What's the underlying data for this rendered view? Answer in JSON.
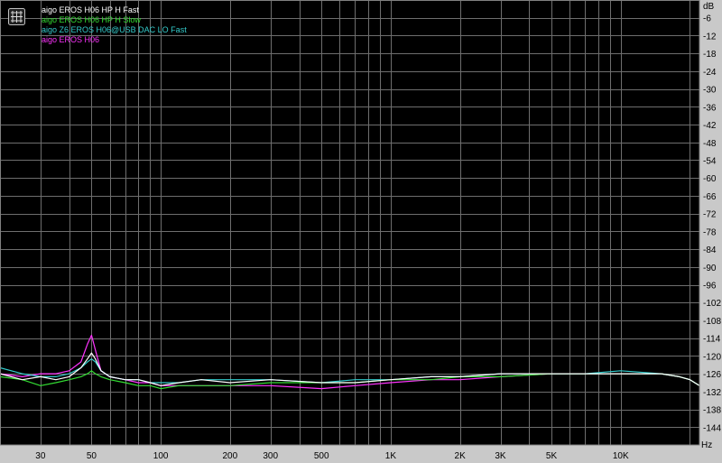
{
  "chart_data": {
    "type": "line",
    "xscale": "log",
    "xlim": [
      20,
      22000
    ],
    "ylim": [
      -150,
      0
    ],
    "grid": true,
    "legend_position": "top-left",
    "y_unit": "dB",
    "x_unit": "Hz",
    "y_ticks": [
      -6,
      -12,
      -18,
      -24,
      -30,
      -36,
      -42,
      -48,
      -54,
      -60,
      -66,
      -72,
      -78,
      -84,
      -90,
      -96,
      -102,
      -108,
      -114,
      -120,
      -126,
      -132,
      -138,
      -144
    ],
    "x_ticks": [
      {
        "value": 30,
        "label": "30"
      },
      {
        "value": 50,
        "label": "50"
      },
      {
        "value": 100,
        "label": "100"
      },
      {
        "value": 200,
        "label": "200"
      },
      {
        "value": 300,
        "label": "300"
      },
      {
        "value": 500,
        "label": "500"
      },
      {
        "value": 1000,
        "label": "1K"
      },
      {
        "value": 2000,
        "label": "2K"
      },
      {
        "value": 3000,
        "label": "3K"
      },
      {
        "value": 5000,
        "label": "5K"
      },
      {
        "value": 10000,
        "label": "10K"
      }
    ],
    "series": [
      {
        "name": "aigo EROS H06 HP H Fast",
        "color": "#ffffff",
        "x": [
          20,
          25,
          30,
          35,
          40,
          45,
          48,
          50,
          52,
          55,
          60,
          70,
          80,
          90,
          100,
          120,
          150,
          200,
          300,
          500,
          700,
          1000,
          1500,
          2000,
          3000,
          5000,
          7000,
          10000,
          15000,
          18000,
          20000,
          22000
        ],
        "y": [
          -126,
          -128,
          -127,
          -128,
          -127,
          -124,
          -121,
          -119,
          -121,
          -125,
          -127,
          -128,
          -128,
          -129,
          -130,
          -129,
          -128,
          -129,
          -128,
          -129,
          -129,
          -128,
          -127,
          -127,
          -126,
          -126,
          -126,
          -126,
          -126,
          -127,
          -128,
          -130
        ]
      },
      {
        "name": "aigo EROS H06 HP H Slow",
        "color": "#33dd33",
        "x": [
          20,
          25,
          30,
          35,
          40,
          45,
          48,
          50,
          52,
          55,
          60,
          70,
          80,
          90,
          100,
          120,
          150,
          200,
          300,
          500,
          700,
          1000,
          1500,
          2000,
          3000,
          5000,
          7000,
          10000,
          15000,
          18000,
          20000,
          22000
        ],
        "y": [
          -127,
          -128,
          -130,
          -129,
          -128,
          -127,
          -126,
          -125,
          -126,
          -127,
          -128,
          -129,
          -130,
          -130,
          -131,
          -130,
          -130,
          -130,
          -129,
          -129,
          -129,
          -128,
          -128,
          -127,
          -127,
          -126,
          -126,
          -126,
          -126,
          -127,
          -128,
          -130
        ]
      },
      {
        "name": "aigo Z6 EROS H06@USB DAC LO Fast",
        "color": "#33cccc",
        "x": [
          20,
          25,
          30,
          35,
          40,
          45,
          48,
          50,
          52,
          55,
          60,
          70,
          80,
          90,
          100,
          120,
          150,
          200,
          300,
          500,
          700,
          1000,
          1500,
          2000,
          3000,
          5000,
          7000,
          10000,
          15000,
          18000,
          20000,
          22000
        ],
        "y": [
          -124,
          -126,
          -127,
          -127,
          -126,
          -124,
          -122,
          -121,
          -122,
          -125,
          -127,
          -128,
          -128,
          -129,
          -129,
          -129,
          -128,
          -128,
          -128,
          -129,
          -128,
          -128,
          -127,
          -127,
          -126,
          -126,
          -126,
          -125,
          -126,
          -127,
          -128,
          -130
        ]
      },
      {
        "name": "aigo EROS H06",
        "color": "#ff33ff",
        "x": [
          20,
          25,
          30,
          35,
          40,
          45,
          48,
          50,
          52,
          55,
          60,
          70,
          80,
          90,
          100,
          120,
          150,
          200,
          300,
          500,
          700,
          1000,
          1500,
          2000,
          3000,
          5000,
          7000,
          10000,
          15000,
          18000,
          20000,
          22000
        ],
        "y": [
          -126,
          -127,
          -126,
          -126,
          -125,
          -122,
          -116,
          -113,
          -118,
          -125,
          -127,
          -128,
          -129,
          -129,
          -130,
          -130,
          -130,
          -130,
          -130,
          -131,
          -130,
          -129,
          -128,
          -128,
          -127,
          -126,
          -126,
          -126,
          -126,
          -127,
          -128,
          -130
        ]
      }
    ]
  }
}
